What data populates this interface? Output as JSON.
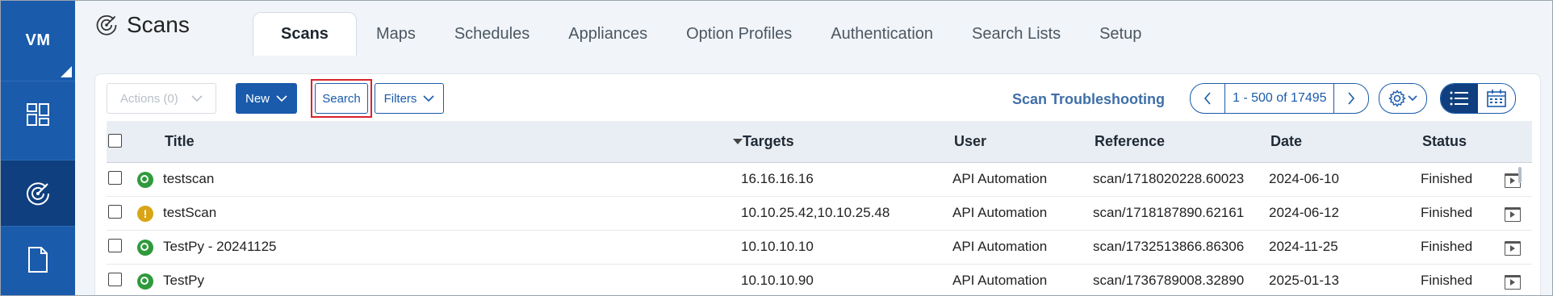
{
  "rail": {
    "logo": "VM",
    "items": [
      {
        "icon": "dashboard-icon",
        "active": false
      },
      {
        "icon": "scan-radar-icon",
        "active": true
      },
      {
        "icon": "document-icon",
        "active": false
      }
    ]
  },
  "header": {
    "app_title": "Scans",
    "tabs": [
      "Scans",
      "Maps",
      "Schedules",
      "Appliances",
      "Option Profiles",
      "Authentication",
      "Search Lists",
      "Setup"
    ],
    "active_tab": "Scans"
  },
  "toolbar": {
    "actions_label": "Actions (0)",
    "new_label": "New",
    "search_label": "Search",
    "filters_label": "Filters",
    "troubleshoot_label": "Scan Troubleshooting",
    "pagination_range": "1 - 500 of 17495",
    "highlight_color": "#d9232d"
  },
  "table": {
    "columns": [
      "Title",
      "Targets",
      "User",
      "Reference",
      "Date",
      "Status"
    ],
    "rows": [
      {
        "status_icon": "ok",
        "title": "testscan",
        "targets": "16.16.16.16",
        "user": "API Automation",
        "reference": "scan/1718020228.60023",
        "date": "2024-06-10",
        "status": "Finished"
      },
      {
        "status_icon": "warn",
        "title": "testScan",
        "targets": "10.10.25.42,10.10.25.48",
        "user": "API Automation",
        "reference": "scan/1718187890.62161",
        "date": "2024-06-12",
        "status": "Finished"
      },
      {
        "status_icon": "ok",
        "title": "TestPy - 20241125",
        "targets": "10.10.10.10",
        "user": "API Automation",
        "reference": "scan/1732513866.86306",
        "date": "2024-11-25",
        "status": "Finished"
      },
      {
        "status_icon": "ok",
        "title": "TestPy",
        "targets": "10.10.10.90",
        "user": "API Automation",
        "reference": "scan/1736789008.32890",
        "date": "2025-01-13",
        "status": "Finished"
      }
    ]
  },
  "colors": {
    "brand": "#1a5bab",
    "rail_active": "#0f3f7e",
    "status_ok": "#2f9a3c",
    "status_warn": "#d9a516"
  }
}
